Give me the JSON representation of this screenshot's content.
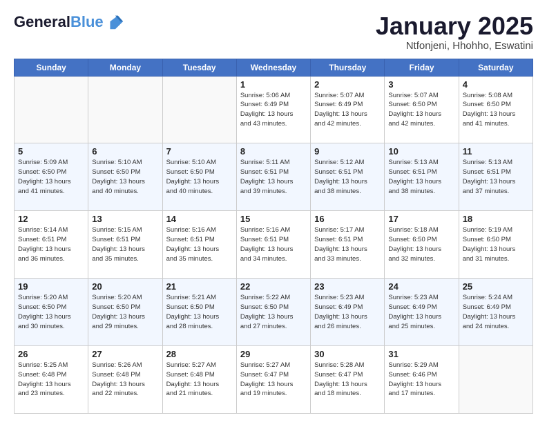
{
  "header": {
    "logo_line1": "General",
    "logo_line2": "Blue",
    "title": "January 2025",
    "subtitle": "Ntfonjeni, Hhohho, Eswatini"
  },
  "weekdays": [
    "Sunday",
    "Monday",
    "Tuesday",
    "Wednesday",
    "Thursday",
    "Friday",
    "Saturday"
  ],
  "weeks": [
    [
      {
        "day": "",
        "info": ""
      },
      {
        "day": "",
        "info": ""
      },
      {
        "day": "",
        "info": ""
      },
      {
        "day": "1",
        "info": "Sunrise: 5:06 AM\nSunset: 6:49 PM\nDaylight: 13 hours\nand 43 minutes."
      },
      {
        "day": "2",
        "info": "Sunrise: 5:07 AM\nSunset: 6:49 PM\nDaylight: 13 hours\nand 42 minutes."
      },
      {
        "day": "3",
        "info": "Sunrise: 5:07 AM\nSunset: 6:50 PM\nDaylight: 13 hours\nand 42 minutes."
      },
      {
        "day": "4",
        "info": "Sunrise: 5:08 AM\nSunset: 6:50 PM\nDaylight: 13 hours\nand 41 minutes."
      }
    ],
    [
      {
        "day": "5",
        "info": "Sunrise: 5:09 AM\nSunset: 6:50 PM\nDaylight: 13 hours\nand 41 minutes."
      },
      {
        "day": "6",
        "info": "Sunrise: 5:10 AM\nSunset: 6:50 PM\nDaylight: 13 hours\nand 40 minutes."
      },
      {
        "day": "7",
        "info": "Sunrise: 5:10 AM\nSunset: 6:50 PM\nDaylight: 13 hours\nand 40 minutes."
      },
      {
        "day": "8",
        "info": "Sunrise: 5:11 AM\nSunset: 6:51 PM\nDaylight: 13 hours\nand 39 minutes."
      },
      {
        "day": "9",
        "info": "Sunrise: 5:12 AM\nSunset: 6:51 PM\nDaylight: 13 hours\nand 38 minutes."
      },
      {
        "day": "10",
        "info": "Sunrise: 5:13 AM\nSunset: 6:51 PM\nDaylight: 13 hours\nand 38 minutes."
      },
      {
        "day": "11",
        "info": "Sunrise: 5:13 AM\nSunset: 6:51 PM\nDaylight: 13 hours\nand 37 minutes."
      }
    ],
    [
      {
        "day": "12",
        "info": "Sunrise: 5:14 AM\nSunset: 6:51 PM\nDaylight: 13 hours\nand 36 minutes."
      },
      {
        "day": "13",
        "info": "Sunrise: 5:15 AM\nSunset: 6:51 PM\nDaylight: 13 hours\nand 35 minutes."
      },
      {
        "day": "14",
        "info": "Sunrise: 5:16 AM\nSunset: 6:51 PM\nDaylight: 13 hours\nand 35 minutes."
      },
      {
        "day": "15",
        "info": "Sunrise: 5:16 AM\nSunset: 6:51 PM\nDaylight: 13 hours\nand 34 minutes."
      },
      {
        "day": "16",
        "info": "Sunrise: 5:17 AM\nSunset: 6:51 PM\nDaylight: 13 hours\nand 33 minutes."
      },
      {
        "day": "17",
        "info": "Sunrise: 5:18 AM\nSunset: 6:50 PM\nDaylight: 13 hours\nand 32 minutes."
      },
      {
        "day": "18",
        "info": "Sunrise: 5:19 AM\nSunset: 6:50 PM\nDaylight: 13 hours\nand 31 minutes."
      }
    ],
    [
      {
        "day": "19",
        "info": "Sunrise: 5:20 AM\nSunset: 6:50 PM\nDaylight: 13 hours\nand 30 minutes."
      },
      {
        "day": "20",
        "info": "Sunrise: 5:20 AM\nSunset: 6:50 PM\nDaylight: 13 hours\nand 29 minutes."
      },
      {
        "day": "21",
        "info": "Sunrise: 5:21 AM\nSunset: 6:50 PM\nDaylight: 13 hours\nand 28 minutes."
      },
      {
        "day": "22",
        "info": "Sunrise: 5:22 AM\nSunset: 6:50 PM\nDaylight: 13 hours\nand 27 minutes."
      },
      {
        "day": "23",
        "info": "Sunrise: 5:23 AM\nSunset: 6:49 PM\nDaylight: 13 hours\nand 26 minutes."
      },
      {
        "day": "24",
        "info": "Sunrise: 5:23 AM\nSunset: 6:49 PM\nDaylight: 13 hours\nand 25 minutes."
      },
      {
        "day": "25",
        "info": "Sunrise: 5:24 AM\nSunset: 6:49 PM\nDaylight: 13 hours\nand 24 minutes."
      }
    ],
    [
      {
        "day": "26",
        "info": "Sunrise: 5:25 AM\nSunset: 6:48 PM\nDaylight: 13 hours\nand 23 minutes."
      },
      {
        "day": "27",
        "info": "Sunrise: 5:26 AM\nSunset: 6:48 PM\nDaylight: 13 hours\nand 22 minutes."
      },
      {
        "day": "28",
        "info": "Sunrise: 5:27 AM\nSunset: 6:48 PM\nDaylight: 13 hours\nand 21 minutes."
      },
      {
        "day": "29",
        "info": "Sunrise: 5:27 AM\nSunset: 6:47 PM\nDaylight: 13 hours\nand 19 minutes."
      },
      {
        "day": "30",
        "info": "Sunrise: 5:28 AM\nSunset: 6:47 PM\nDaylight: 13 hours\nand 18 minutes."
      },
      {
        "day": "31",
        "info": "Sunrise: 5:29 AM\nSunset: 6:46 PM\nDaylight: 13 hours\nand 17 minutes."
      },
      {
        "day": "",
        "info": ""
      }
    ]
  ]
}
